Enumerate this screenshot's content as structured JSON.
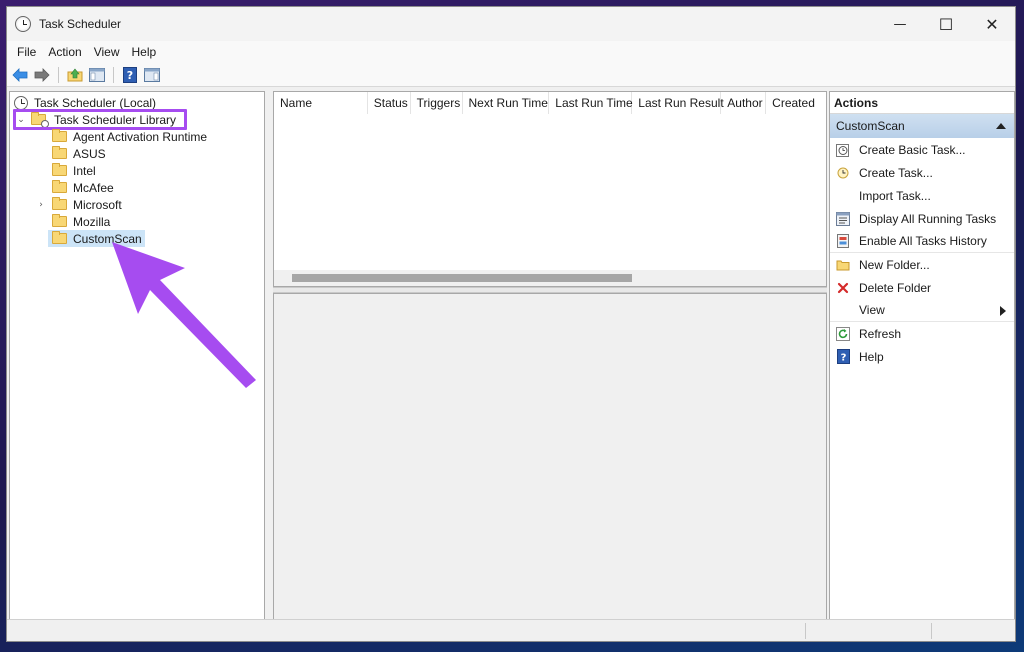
{
  "window": {
    "title": "Task Scheduler"
  },
  "window_controls": {
    "minimize": "—",
    "maximize": "☐",
    "close": "✕"
  },
  "menu": [
    "File",
    "Action",
    "View",
    "Help"
  ],
  "toolbar": {
    "buttons": [
      "back-icon",
      "forward-icon",
      "up-folder-icon",
      "show-hide-console-tree-icon",
      "help-icon",
      "show-hide-action-pane-icon"
    ]
  },
  "tree": {
    "root": "Task Scheduler (Local)",
    "library": "Task Scheduler Library",
    "folders": [
      "Agent Activation Runtime",
      "ASUS",
      "Intel",
      "McAfee",
      "Microsoft",
      "Mozilla",
      "CustomScan"
    ],
    "selected": "CustomScan"
  },
  "task_list": {
    "columns": [
      "Name",
      "Status",
      "Triggers",
      "Next Run Time",
      "Last Run Time",
      "Last Run Result",
      "Author",
      "Created"
    ]
  },
  "actions": {
    "header": "Actions",
    "section": "CustomScan",
    "items": [
      {
        "label": "Create Basic Task...",
        "icon": "create-basic-task-icon"
      },
      {
        "label": "Create Task...",
        "icon": "create-task-icon"
      },
      {
        "label": "Import Task...",
        "icon": ""
      },
      {
        "label": "Display All Running Tasks",
        "icon": "running-tasks-icon"
      },
      {
        "label": "Enable All Tasks History",
        "icon": "history-icon"
      },
      {
        "label": "New Folder...",
        "icon": "new-folder-icon"
      },
      {
        "label": "Delete Folder",
        "icon": "delete-icon"
      },
      {
        "label": "View",
        "icon": ""
      },
      {
        "label": "Refresh",
        "icon": "refresh-icon"
      },
      {
        "label": "Help",
        "icon": "help-icon"
      }
    ]
  },
  "colors": {
    "annotation": "#a64cf0",
    "selection": "#cce4f7",
    "section_header": "#c4d7ee"
  }
}
